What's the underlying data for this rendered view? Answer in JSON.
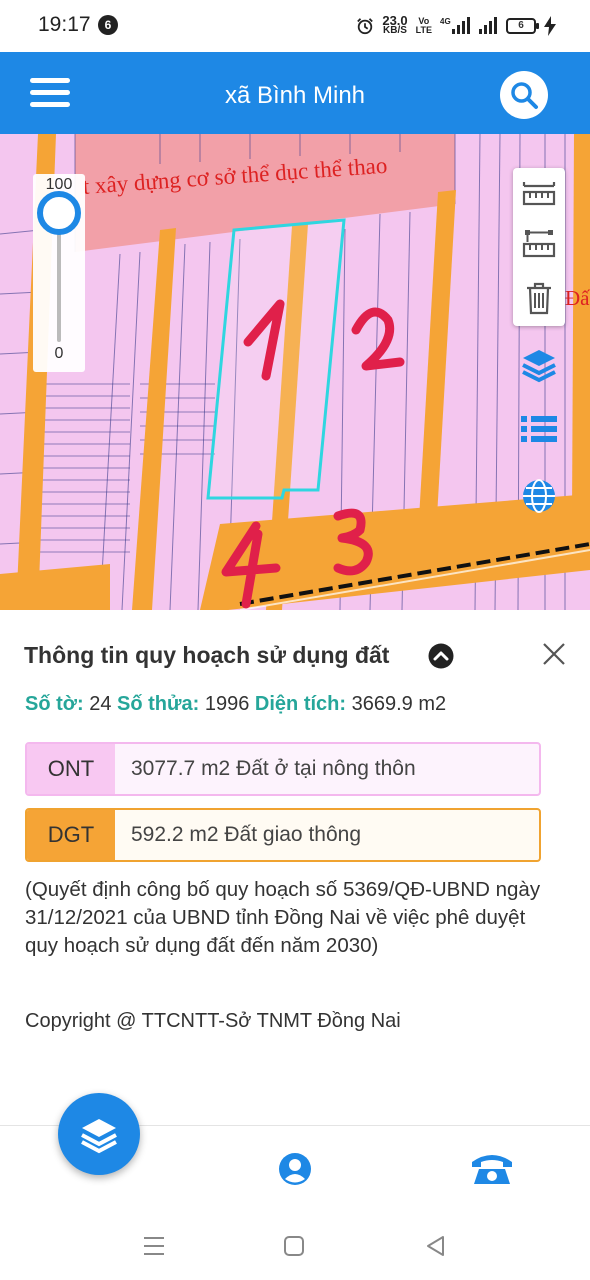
{
  "status_bar": {
    "time": "19:17",
    "notification_count": "6",
    "net_speed_value": "23.0",
    "net_speed_unit": "KB/S",
    "volte_top": "Vo",
    "volte_bottom": "LTE",
    "network_type": "4G",
    "battery_level": "6"
  },
  "header": {
    "title": "xã Bình Minh",
    "menu_icon": "hamburger-menu-icon",
    "search_icon": "search-icon"
  },
  "map": {
    "zone_label": "t xây dựng cơ sở thể dục thể thao",
    "right_edge_label": "Đấ",
    "zoom": {
      "max_label": "100",
      "min_label": "0",
      "level": 1.0
    },
    "handwritten_marks": [
      "1",
      "2",
      "3",
      "4"
    ],
    "tools": [
      "measure-distance-icon",
      "measure-area-icon",
      "trash-icon"
    ],
    "side_buttons": [
      "layers-icon",
      "list-icon",
      "globe-icon"
    ],
    "colors": {
      "residential": "#f4c6ef",
      "road": "#f5a436",
      "sports_zone": "#f2a0a8",
      "parcel_outline": "#2fd6e0",
      "handwriting": "#e0204a"
    }
  },
  "info": {
    "title": "Thông tin quy hoạch sử dụng đất",
    "collapse_icon": "chevron-up-circle-icon",
    "close_icon": "close-icon",
    "so_to_label": "Số tờ:",
    "so_to_value": "24",
    "so_thua_label": "Số thửa:",
    "so_thua_value": "1996",
    "dien_tich_label": "Diện tích:",
    "dien_tich_value": "3669.9 m2",
    "land_use": [
      {
        "code": "ONT",
        "description": "3077.7 m2 Đất ở tại nông thôn",
        "color": "#f8c8f2"
      },
      {
        "code": "DGT",
        "description": "592.2 m2 Đất giao thông",
        "color": "#f5a436"
      }
    ],
    "decision_note": "(Quyết định công bố quy hoạch số 5369/QĐ-UBND ngày 31/12/2021 của UBND tỉnh Đồng Nai về việc phê duyệt quy hoạch sử dụng đất đến năm 2030)",
    "copyright": "Copyright @ TTCNTT-Sở TNMT Đồng Nai"
  },
  "bottom_nav": {
    "items": [
      "layers-icon",
      "user-icon",
      "phone-icon"
    ],
    "accent_color": "#1e88e5"
  },
  "android_nav": {
    "buttons": [
      "recent-apps-icon",
      "home-icon",
      "back-icon"
    ]
  }
}
